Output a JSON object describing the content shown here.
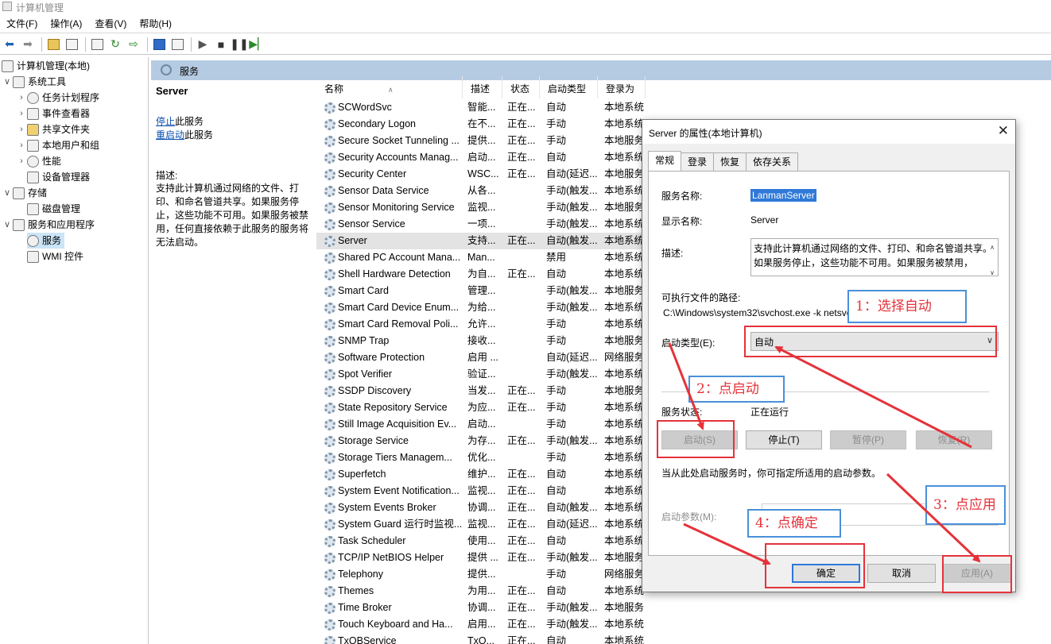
{
  "window": {
    "title": "计算机管理"
  },
  "menu": [
    "文件(F)",
    "操作(A)",
    "查看(V)",
    "帮助(H)"
  ],
  "tree": {
    "root": "计算机管理(本地)",
    "system_tools": "系统工具",
    "task_scheduler": "任务计划程序",
    "event_viewer": "事件查看器",
    "shared_folders": "共享文件夹",
    "local_users": "本地用户和组",
    "performance": "性能",
    "device_manager": "设备管理器",
    "storage": "存储",
    "disk_management": "磁盘管理",
    "services_apps": "服务和应用程序",
    "services": "服务",
    "wmi": "WMI 控件"
  },
  "panel": {
    "header": "服务",
    "service_name": "Server",
    "stop_link": "停止",
    "stop_suffix": "此服务",
    "restart_link": "重启动",
    "restart_suffix": "此服务",
    "desc_label": "描述:",
    "desc_text": "支持此计算机通过网络的文件、打印、和命名管道共享。如果服务停止，这些功能不可用。如果服务被禁用，任何直接依赖于此服务的服务将无法启动。"
  },
  "columns": [
    "名称",
    "描述",
    "状态",
    "启动类型",
    "登录为"
  ],
  "rows": [
    [
      "SCWordSvc",
      "智能...",
      "正在...",
      "自动",
      "本地系统"
    ],
    [
      "Secondary Logon",
      "在不...",
      "正在...",
      "手动",
      "本地系统"
    ],
    [
      "Secure Socket Tunneling ...",
      "提供...",
      "正在...",
      "手动",
      "本地服务"
    ],
    [
      "Security Accounts Manag...",
      "启动...",
      "正在...",
      "自动",
      "本地系统"
    ],
    [
      "Security Center",
      "WSC...",
      "正在...",
      "自动(延迟...",
      "本地服务"
    ],
    [
      "Sensor Data Service",
      "从各...",
      "",
      "手动(触发...",
      "本地系统"
    ],
    [
      "Sensor Monitoring Service",
      "监视...",
      "",
      "手动(触发...",
      "本地服务"
    ],
    [
      "Sensor Service",
      "一项...",
      "",
      "手动(触发...",
      "本地系统"
    ],
    [
      "Server",
      "支持...",
      "正在...",
      "自动(触发...",
      "本地系统"
    ],
    [
      "Shared PC Account Mana...",
      "Man...",
      "",
      "禁用",
      "本地系统"
    ],
    [
      "Shell Hardware Detection",
      "为自...",
      "正在...",
      "自动",
      "本地系统"
    ],
    [
      "Smart Card",
      "管理...",
      "",
      "手动(触发...",
      "本地服务"
    ],
    [
      "Smart Card Device Enum...",
      "为给...",
      "",
      "手动(触发...",
      "本地系统"
    ],
    [
      "Smart Card Removal Poli...",
      "允许...",
      "",
      "手动",
      "本地系统"
    ],
    [
      "SNMP Trap",
      "接收...",
      "",
      "手动",
      "本地服务"
    ],
    [
      "Software Protection",
      "启用 ...",
      "",
      "自动(延迟...",
      "网络服务"
    ],
    [
      "Spot Verifier",
      "验证...",
      "",
      "手动(触发...",
      "本地系统"
    ],
    [
      "SSDP Discovery",
      "当发...",
      "正在...",
      "手动",
      "本地服务"
    ],
    [
      "State Repository Service",
      "为应...",
      "正在...",
      "手动",
      "本地系统"
    ],
    [
      "Still Image Acquisition Ev...",
      "启动...",
      "",
      "手动",
      "本地系统"
    ],
    [
      "Storage Service",
      "为存...",
      "正在...",
      "手动(触发...",
      "本地系统"
    ],
    [
      "Storage Tiers Managem...",
      "优化...",
      "",
      "手动",
      "本地系统"
    ],
    [
      "Superfetch",
      "维护...",
      "正在...",
      "自动",
      "本地系统"
    ],
    [
      "System Event Notification...",
      "监视...",
      "正在...",
      "自动",
      "本地系统"
    ],
    [
      "System Events Broker",
      "协调...",
      "正在...",
      "自动(触发...",
      "本地系统"
    ],
    [
      "System Guard 运行时监视...",
      "监视...",
      "正在...",
      "自动(延迟...",
      "本地系统"
    ],
    [
      "Task Scheduler",
      "使用...",
      "正在...",
      "自动",
      "本地系统"
    ],
    [
      "TCP/IP NetBIOS Helper",
      "提供 ...",
      "正在...",
      "手动(触发...",
      "本地服务"
    ],
    [
      "Telephony",
      "提供...",
      "",
      "手动",
      "网络服务"
    ],
    [
      "Themes",
      "为用...",
      "正在...",
      "自动",
      "本地系统"
    ],
    [
      "Time Broker",
      "协调...",
      "正在...",
      "手动(触发...",
      "本地服务"
    ],
    [
      "Touch Keyboard and Ha...",
      "启用...",
      "正在...",
      "手动(触发...",
      "本地系统"
    ],
    [
      "TxQBService",
      "TxQ...",
      "正在...",
      "自动",
      "本地系统"
    ]
  ],
  "dialog": {
    "title": "Server 的属性(本地计算机)",
    "close": "✕",
    "tabs": [
      "常规",
      "登录",
      "恢复",
      "依存关系"
    ],
    "service_name_label": "服务名称:",
    "service_name_value": "LanmanServer",
    "display_name_label": "显示名称:",
    "display_name_value": "Server",
    "desc_label": "描述:",
    "desc_value": "支持此计算机通过网络的文件、打印、和命名管道共享。如果服务停止，这些功能不可用。如果服务被禁用，",
    "path_label": "可执行文件的路径:",
    "path_value": "C:\\Windows\\system32\\svchost.exe -k netsvcs -p",
    "startup_label": "启动类型(E):",
    "startup_value": "自动",
    "status_label": "服务状态:",
    "status_value": "正在运行",
    "btn_start": "启动(S)",
    "btn_stop": "停止(T)",
    "btn_pause": "暂停(P)",
    "btn_resume": "恢复(R)",
    "hint": "当从此处启动服务时，你可指定所适用的启动参数。",
    "params_label": "启动参数(M):",
    "btn_ok": "确定",
    "btn_cancel": "取消",
    "btn_apply": "应用(A)"
  },
  "annotations": {
    "a1": "1：选择自动",
    "a2": "2：点启动",
    "a3": "3：点应用",
    "a4": "4：点确定",
    "color": "#e5323a",
    "box_color": "#4a90d9"
  }
}
